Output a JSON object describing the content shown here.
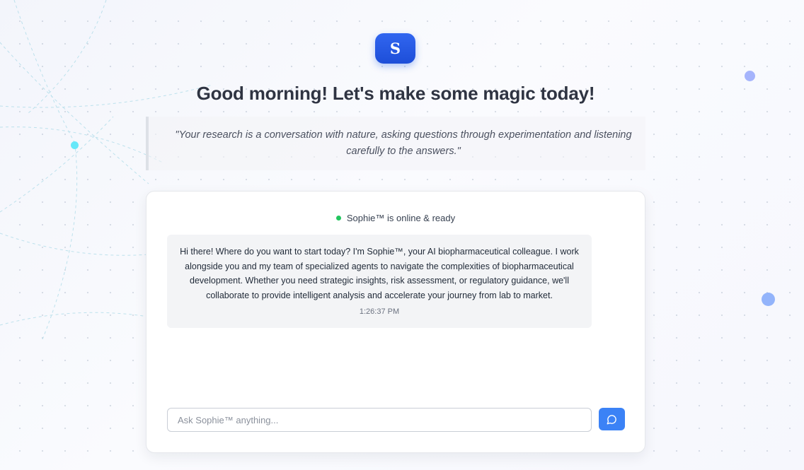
{
  "app": {
    "logo_letter": "S",
    "greeting": "Good morning! Let's make some magic today!",
    "quote": "\"Your research is a conversation with nature, asking questions through experimentation and listening carefully to the answers.\""
  },
  "chat": {
    "status_text": "Sophie™ is online & ready",
    "messages": [
      {
        "sender": "Sophie",
        "text": "Hi there! Where do you want to start today? I'm Sophie™, your AI biopharmaceutical colleague. I work alongside you and my team of specialized agents to navigate the complexities of biopharmaceutical development. Whether you need strategic insights, risk assessment, or regulatory guidance, we'll collaborate to provide intelligent analysis and accelerate your journey from lab to market.",
        "time": "1:26:37 PM"
      }
    ],
    "input": {
      "value": "",
      "placeholder": "Ask Sophie™ anything..."
    },
    "send_icon": "message-circle-icon"
  },
  "colors": {
    "accent": "#3b82f6",
    "logo": "#2563eb",
    "online": "#22c55e",
    "message_bg": "#f3f4f6"
  }
}
